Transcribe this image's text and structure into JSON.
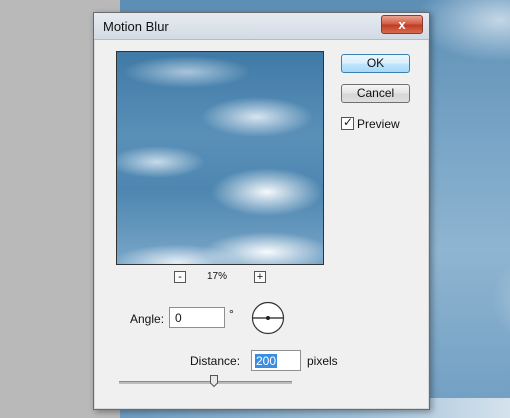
{
  "dialog": {
    "title": "Motion Blur",
    "close_label": "x"
  },
  "zoom": {
    "minus_label": "-",
    "level": "17%",
    "plus_label": "+"
  },
  "buttons": {
    "ok_label": "OK",
    "cancel_label": "Cancel"
  },
  "preview_option": {
    "label": "Preview",
    "checked": true
  },
  "angle": {
    "label": "Angle:",
    "value": "0",
    "unit": "°"
  },
  "distance": {
    "label": "Distance:",
    "value": "200",
    "unit": "pixels"
  },
  "slider": {
    "level_fraction": 0.55
  }
}
